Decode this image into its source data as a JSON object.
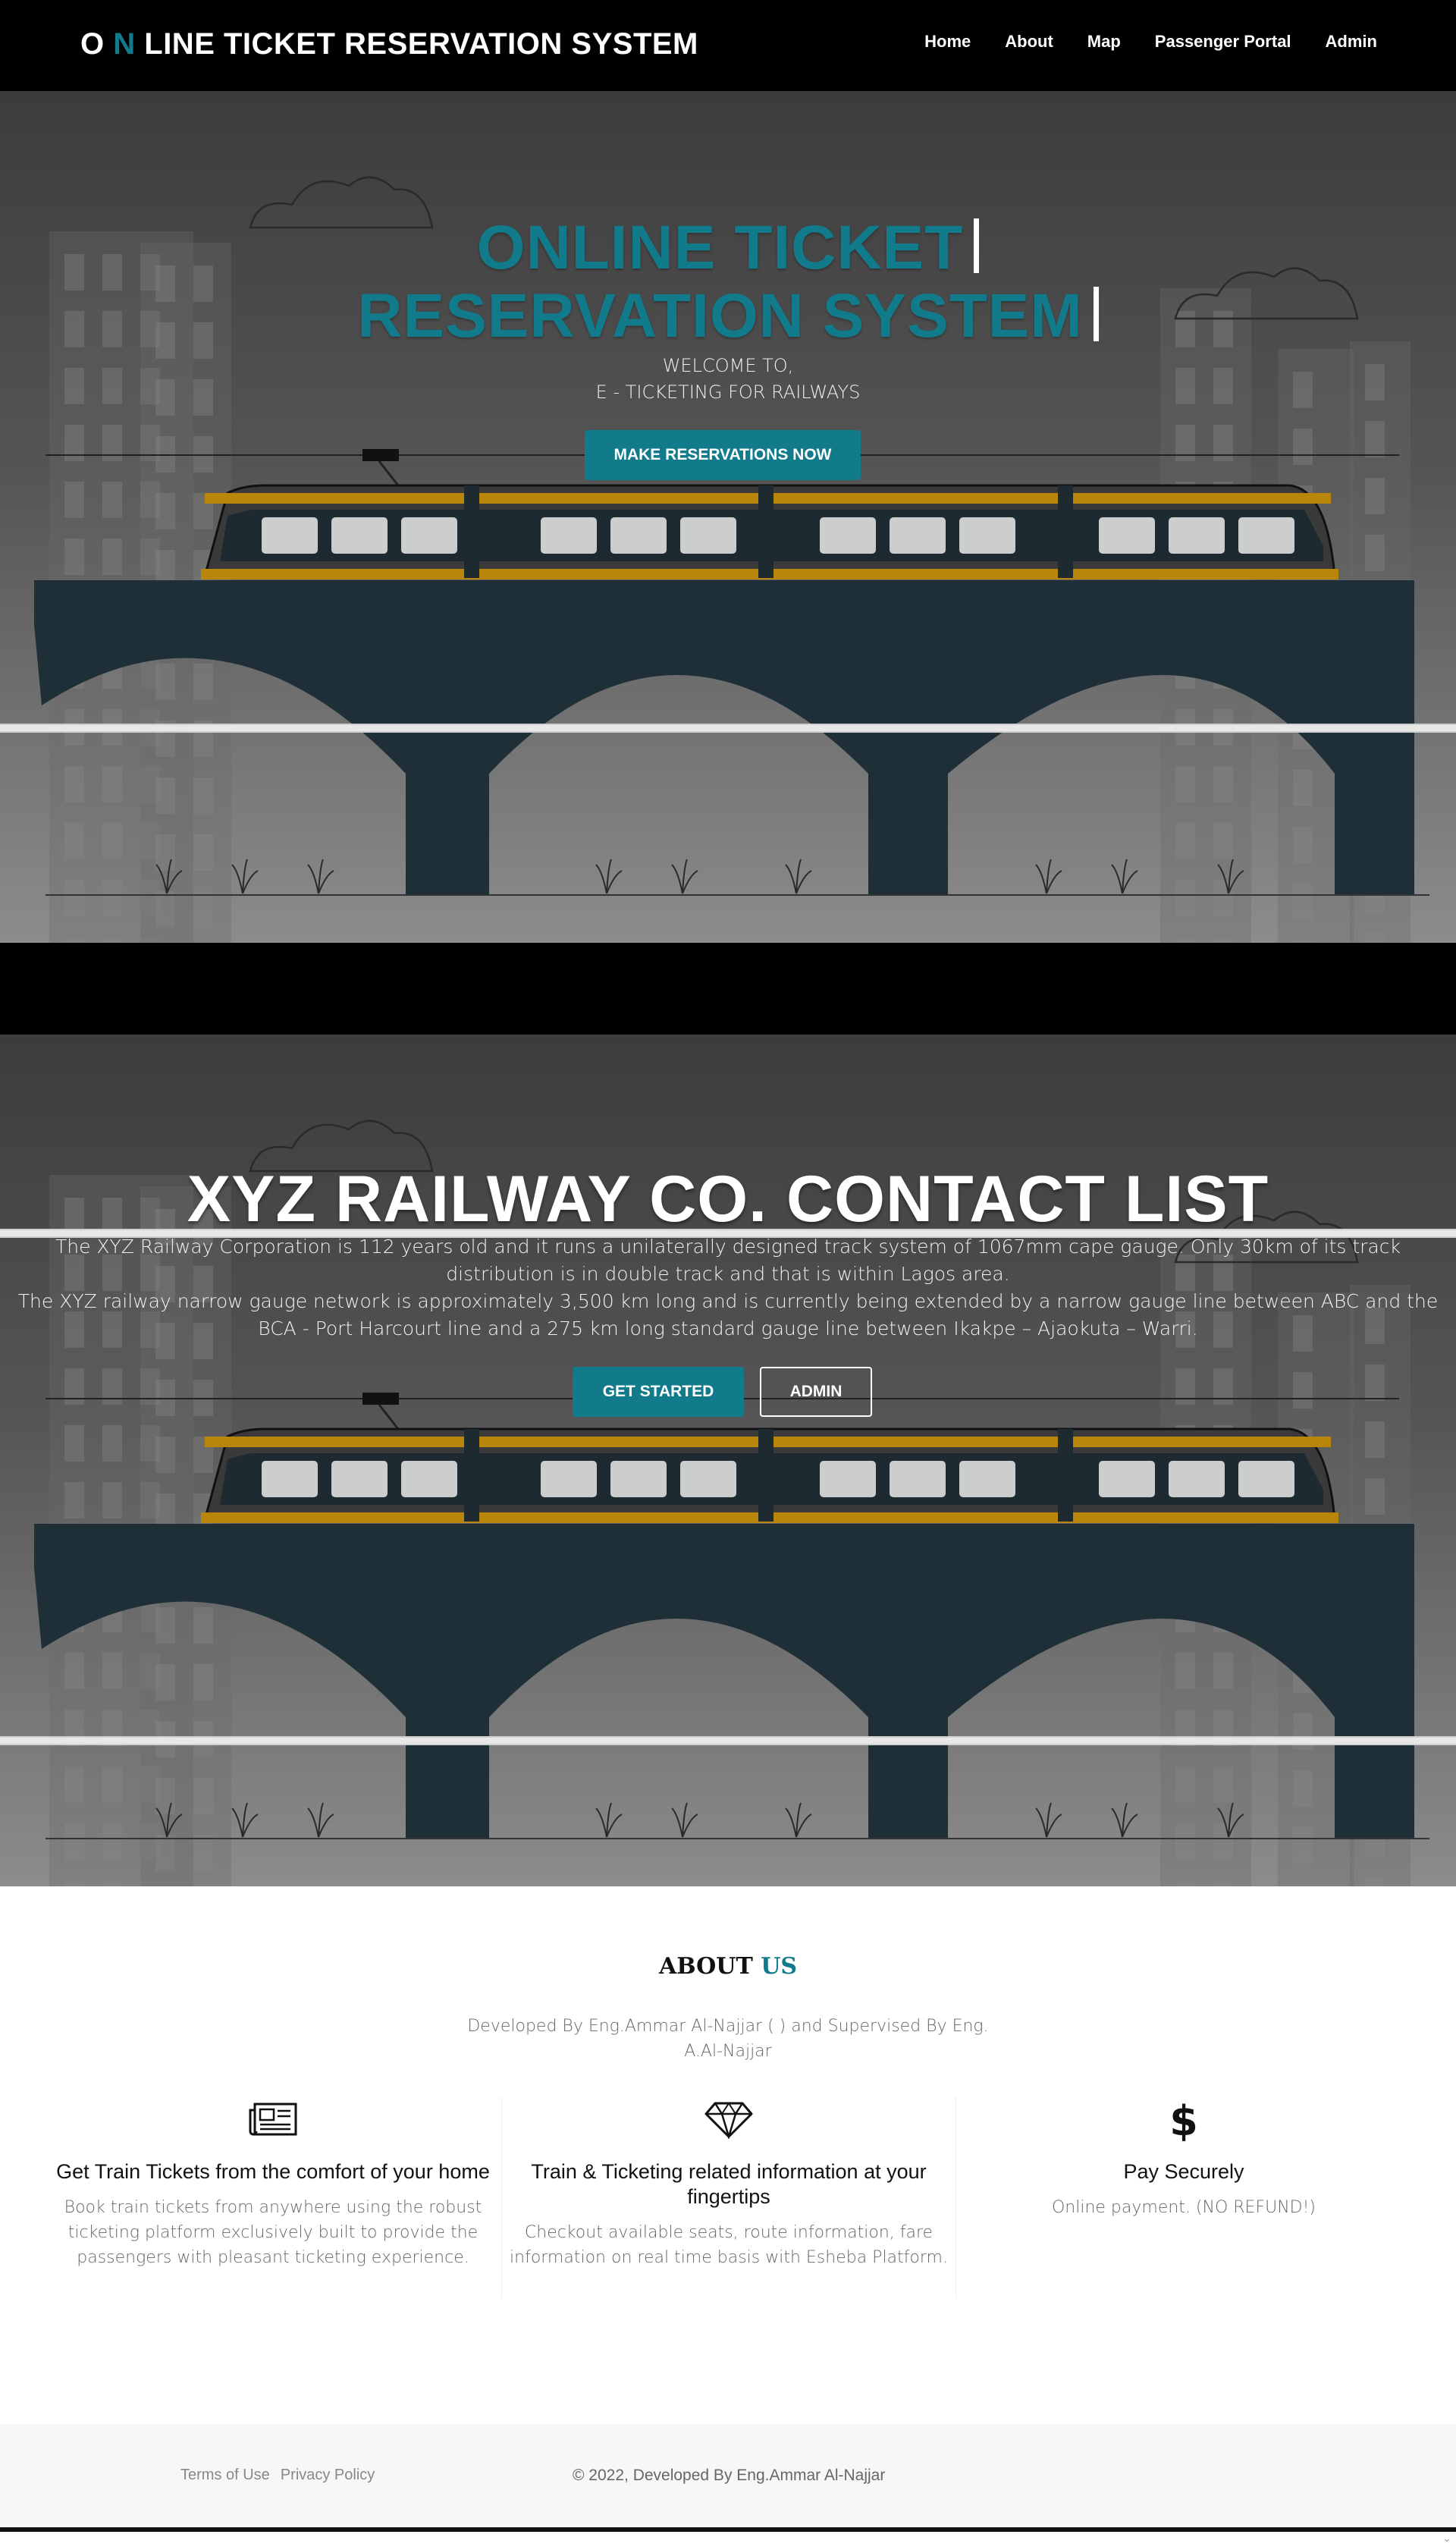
{
  "navbar": {
    "brand_prefix": "O",
    "brand_accent": "N",
    "brand_rest": " LINE TICKET RESERVATION SYSTEM",
    "links": [
      "Home",
      "About",
      "Map",
      "Passenger Portal",
      "Admin"
    ]
  },
  "hero": {
    "title_line1": "ONLINE TICKET",
    "title_line2": "RESERVATION SYSTEM",
    "welcome_line1": "WELCOME TO,",
    "welcome_line2": "E - TICKETING FOR RAILWAYS",
    "cta_label": "MAKE RESERVATIONS NOW"
  },
  "contact": {
    "title": "XYZ RAILWAY CO. CONTACT LIST",
    "desc_line1": "The XYZ Railway Corporation is 112 years old and it runs a unilaterally designed track system of 1067mm cape gauge. Only 30km of its track distribution is in double track and that is within Lagos area.",
    "desc_line2": "The XYZ railway narrow gauge network is approximately 3,500 km long and is currently being extended by a narrow gauge line between ABC and the BCA - Port Harcourt line and a 275 km long standard gauge line between Ikakpe – Ajaokuta – Warri.",
    "get_started_label": "GET STARTED",
    "admin_label": "ADMIN"
  },
  "about": {
    "title_main": "ABOUT ",
    "title_accent": "US",
    "subtitle": "Developed By Eng.Ammar Al-Najjar ( ) and Supervised By Eng. A.Al-Najjar",
    "features": [
      {
        "icon": "newspaper-icon",
        "title": "Get Train Tickets from the comfort of your home",
        "text": "Book train tickets from anywhere using the robust ticketing platform exclusively built to provide the passengers with pleasant ticketing experience."
      },
      {
        "icon": "diamond-icon",
        "title": "Train & Ticketing related information at your fingertips",
        "text": "Checkout available seats, route information, fare information on real time basis with Esheba Platform."
      },
      {
        "icon": "dollar-icon",
        "title": "Pay Securely",
        "text": "Online payment. (NO REFUND!)"
      }
    ]
  },
  "footer": {
    "terms": "Terms of Use",
    "privacy": "Privacy Policy",
    "copyright": "© 2022, Developed By Eng.Ammar Al-Najjar"
  },
  "colors": {
    "accent": "#117b8c",
    "navbar_bg": "#000000",
    "bridge": "#1e2f37",
    "train_stripe": "#b8860b"
  }
}
